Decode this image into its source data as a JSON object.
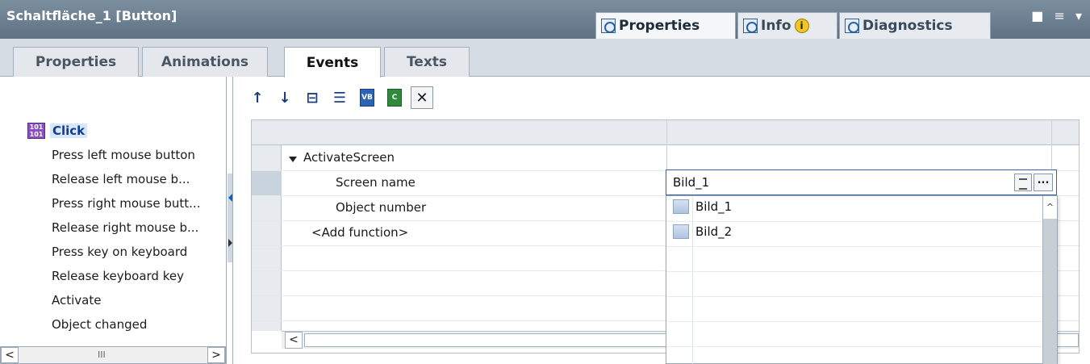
{
  "titlebar": {
    "title": "Schaltfläche_1 [Button]",
    "tabs": [
      {
        "label": "Properties",
        "icon": "properties-icon",
        "active": true
      },
      {
        "label": "Info",
        "icon": "info-icon",
        "badge": "i",
        "active": false
      },
      {
        "label": "Diagnostics",
        "icon": "diagnostics-icon",
        "active": false
      }
    ],
    "window_controls": "■ ≡ ▾"
  },
  "tabs": [
    {
      "label": "Properties",
      "active": false
    },
    {
      "label": "Animations",
      "active": false
    },
    {
      "label": "Events",
      "active": true
    },
    {
      "label": "Texts",
      "active": false
    }
  ],
  "events": {
    "selected": "Click",
    "items": [
      "Press left mouse button",
      "Release left mouse b...",
      "Press right mouse butt...",
      "Release right mouse b...",
      "Press key on keyboard",
      "Release keyboard key",
      "Activate",
      "Object changed"
    ],
    "scroll_left": "<",
    "scroll_right": ">",
    "scroll_grip": "III"
  },
  "toolbar": {
    "buttons": [
      {
        "name": "move-up-icon",
        "glyph": "↑"
      },
      {
        "name": "move-down-icon",
        "glyph": "↓"
      },
      {
        "name": "collapse-all-icon",
        "glyph": "⊟"
      },
      {
        "name": "expand-all-icon",
        "glyph": "☰"
      },
      {
        "name": "convert-to-vb-icon",
        "glyph": "VB"
      },
      {
        "name": "convert-to-c-icon",
        "glyph": "C"
      },
      {
        "name": "delete-icon",
        "glyph": "✕"
      }
    ]
  },
  "grid": {
    "function": "ActivateScreen",
    "param1": "Screen name",
    "param2": "Object number",
    "add_function": "<Add function>",
    "scroll_left": "<"
  },
  "value_editor": {
    "value": "Bild_1",
    "more": "..."
  },
  "dropdown": {
    "options": [
      "Bild_1",
      "Bild_2"
    ],
    "scroll_up": "^"
  }
}
